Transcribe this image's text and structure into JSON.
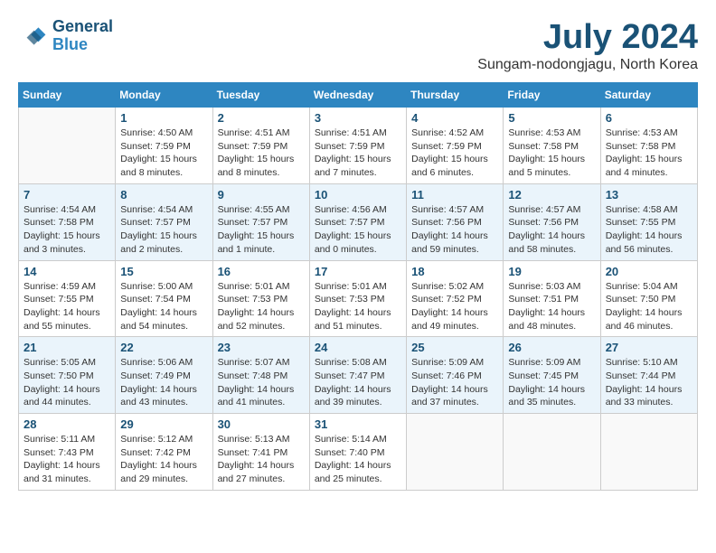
{
  "header": {
    "logo_line1": "General",
    "logo_line2": "Blue",
    "month_title": "July 2024",
    "location": "Sungam-nodongjagu, North Korea"
  },
  "days_of_week": [
    "Sunday",
    "Monday",
    "Tuesday",
    "Wednesday",
    "Thursday",
    "Friday",
    "Saturday"
  ],
  "weeks": [
    [
      {
        "day": "",
        "sunrise": "",
        "sunset": "",
        "daylight": ""
      },
      {
        "day": "1",
        "sunrise": "Sunrise: 4:50 AM",
        "sunset": "Sunset: 7:59 PM",
        "daylight": "Daylight: 15 hours and 8 minutes."
      },
      {
        "day": "2",
        "sunrise": "Sunrise: 4:51 AM",
        "sunset": "Sunset: 7:59 PM",
        "daylight": "Daylight: 15 hours and 8 minutes."
      },
      {
        "day": "3",
        "sunrise": "Sunrise: 4:51 AM",
        "sunset": "Sunset: 7:59 PM",
        "daylight": "Daylight: 15 hours and 7 minutes."
      },
      {
        "day": "4",
        "sunrise": "Sunrise: 4:52 AM",
        "sunset": "Sunset: 7:59 PM",
        "daylight": "Daylight: 15 hours and 6 minutes."
      },
      {
        "day": "5",
        "sunrise": "Sunrise: 4:53 AM",
        "sunset": "Sunset: 7:58 PM",
        "daylight": "Daylight: 15 hours and 5 minutes."
      },
      {
        "day": "6",
        "sunrise": "Sunrise: 4:53 AM",
        "sunset": "Sunset: 7:58 PM",
        "daylight": "Daylight: 15 hours and 4 minutes."
      }
    ],
    [
      {
        "day": "7",
        "sunrise": "Sunrise: 4:54 AM",
        "sunset": "Sunset: 7:58 PM",
        "daylight": "Daylight: 15 hours and 3 minutes."
      },
      {
        "day": "8",
        "sunrise": "Sunrise: 4:54 AM",
        "sunset": "Sunset: 7:57 PM",
        "daylight": "Daylight: 15 hours and 2 minutes."
      },
      {
        "day": "9",
        "sunrise": "Sunrise: 4:55 AM",
        "sunset": "Sunset: 7:57 PM",
        "daylight": "Daylight: 15 hours and 1 minute."
      },
      {
        "day": "10",
        "sunrise": "Sunrise: 4:56 AM",
        "sunset": "Sunset: 7:57 PM",
        "daylight": "Daylight: 15 hours and 0 minutes."
      },
      {
        "day": "11",
        "sunrise": "Sunrise: 4:57 AM",
        "sunset": "Sunset: 7:56 PM",
        "daylight": "Daylight: 14 hours and 59 minutes."
      },
      {
        "day": "12",
        "sunrise": "Sunrise: 4:57 AM",
        "sunset": "Sunset: 7:56 PM",
        "daylight": "Daylight: 14 hours and 58 minutes."
      },
      {
        "day": "13",
        "sunrise": "Sunrise: 4:58 AM",
        "sunset": "Sunset: 7:55 PM",
        "daylight": "Daylight: 14 hours and 56 minutes."
      }
    ],
    [
      {
        "day": "14",
        "sunrise": "Sunrise: 4:59 AM",
        "sunset": "Sunset: 7:55 PM",
        "daylight": "Daylight: 14 hours and 55 minutes."
      },
      {
        "day": "15",
        "sunrise": "Sunrise: 5:00 AM",
        "sunset": "Sunset: 7:54 PM",
        "daylight": "Daylight: 14 hours and 54 minutes."
      },
      {
        "day": "16",
        "sunrise": "Sunrise: 5:01 AM",
        "sunset": "Sunset: 7:53 PM",
        "daylight": "Daylight: 14 hours and 52 minutes."
      },
      {
        "day": "17",
        "sunrise": "Sunrise: 5:01 AM",
        "sunset": "Sunset: 7:53 PM",
        "daylight": "Daylight: 14 hours and 51 minutes."
      },
      {
        "day": "18",
        "sunrise": "Sunrise: 5:02 AM",
        "sunset": "Sunset: 7:52 PM",
        "daylight": "Daylight: 14 hours and 49 minutes."
      },
      {
        "day": "19",
        "sunrise": "Sunrise: 5:03 AM",
        "sunset": "Sunset: 7:51 PM",
        "daylight": "Daylight: 14 hours and 48 minutes."
      },
      {
        "day": "20",
        "sunrise": "Sunrise: 5:04 AM",
        "sunset": "Sunset: 7:50 PM",
        "daylight": "Daylight: 14 hours and 46 minutes."
      }
    ],
    [
      {
        "day": "21",
        "sunrise": "Sunrise: 5:05 AM",
        "sunset": "Sunset: 7:50 PM",
        "daylight": "Daylight: 14 hours and 44 minutes."
      },
      {
        "day": "22",
        "sunrise": "Sunrise: 5:06 AM",
        "sunset": "Sunset: 7:49 PM",
        "daylight": "Daylight: 14 hours and 43 minutes."
      },
      {
        "day": "23",
        "sunrise": "Sunrise: 5:07 AM",
        "sunset": "Sunset: 7:48 PM",
        "daylight": "Daylight: 14 hours and 41 minutes."
      },
      {
        "day": "24",
        "sunrise": "Sunrise: 5:08 AM",
        "sunset": "Sunset: 7:47 PM",
        "daylight": "Daylight: 14 hours and 39 minutes."
      },
      {
        "day": "25",
        "sunrise": "Sunrise: 5:09 AM",
        "sunset": "Sunset: 7:46 PM",
        "daylight": "Daylight: 14 hours and 37 minutes."
      },
      {
        "day": "26",
        "sunrise": "Sunrise: 5:09 AM",
        "sunset": "Sunset: 7:45 PM",
        "daylight": "Daylight: 14 hours and 35 minutes."
      },
      {
        "day": "27",
        "sunrise": "Sunrise: 5:10 AM",
        "sunset": "Sunset: 7:44 PM",
        "daylight": "Daylight: 14 hours and 33 minutes."
      }
    ],
    [
      {
        "day": "28",
        "sunrise": "Sunrise: 5:11 AM",
        "sunset": "Sunset: 7:43 PM",
        "daylight": "Daylight: 14 hours and 31 minutes."
      },
      {
        "day": "29",
        "sunrise": "Sunrise: 5:12 AM",
        "sunset": "Sunset: 7:42 PM",
        "daylight": "Daylight: 14 hours and 29 minutes."
      },
      {
        "day": "30",
        "sunrise": "Sunrise: 5:13 AM",
        "sunset": "Sunset: 7:41 PM",
        "daylight": "Daylight: 14 hours and 27 minutes."
      },
      {
        "day": "31",
        "sunrise": "Sunrise: 5:14 AM",
        "sunset": "Sunset: 7:40 PM",
        "daylight": "Daylight: 14 hours and 25 minutes."
      },
      {
        "day": "",
        "sunrise": "",
        "sunset": "",
        "daylight": ""
      },
      {
        "day": "",
        "sunrise": "",
        "sunset": "",
        "daylight": ""
      },
      {
        "day": "",
        "sunrise": "",
        "sunset": "",
        "daylight": ""
      }
    ]
  ]
}
